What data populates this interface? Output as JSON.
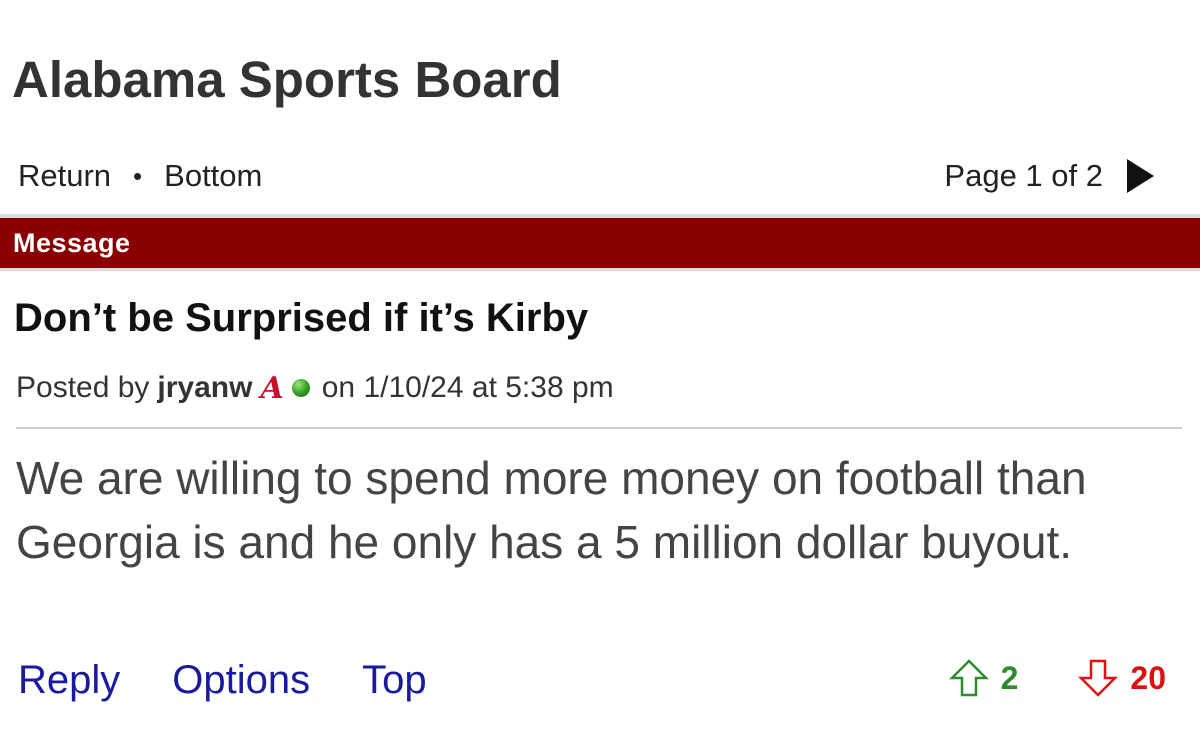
{
  "board": {
    "title": "Alabama Sports Board"
  },
  "nav": {
    "return_label": "Return",
    "separator": "•",
    "bottom_label": "Bottom",
    "page_info": "Page 1 of 2"
  },
  "section": {
    "label": "Message"
  },
  "post": {
    "title": "Don’t be Surprised if it’s Kirby",
    "posted_by_prefix": "Posted by",
    "author": "jryanw",
    "team_logo_letter": "A",
    "date_text": "on 1/10/24 at 5:38 pm",
    "body": "We are willing to spend more money on football than Georgia is and he only has a 5 million dollar buyout."
  },
  "actions": {
    "reply_label": "Reply",
    "options_label": "Options",
    "top_label": "Top"
  },
  "votes": {
    "up_count": "2",
    "down_count": "20"
  },
  "colors": {
    "message_bar": "#8a0000",
    "link_blue": "#1a1a9e",
    "upvote_green": "#2e8b2e",
    "downvote_red": "#dd1111"
  },
  "icons": {
    "next_page": "triangle-right-icon",
    "upvote": "arrow-up-outline-icon",
    "downvote": "arrow-down-outline-icon",
    "online_status": "green-dot-icon"
  }
}
